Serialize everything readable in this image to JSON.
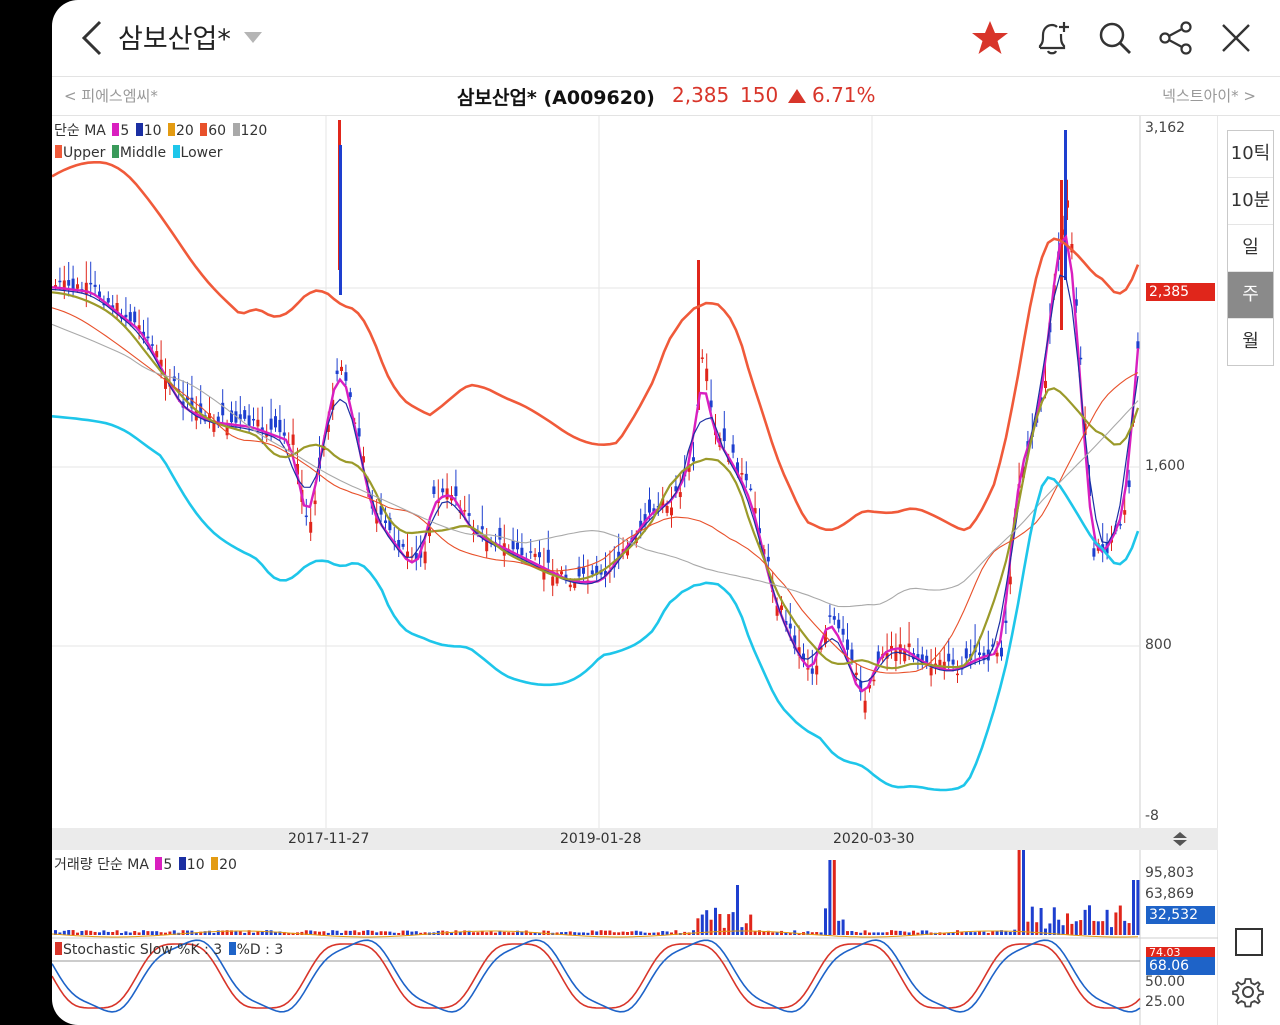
{
  "header": {
    "title": "삼보산업*",
    "icons": [
      "back-icon",
      "star-icon",
      "alarm-add-icon",
      "search-icon",
      "share-icon",
      "close-icon"
    ]
  },
  "stock_bar": {
    "prev_stock": "< 피에스엠씨*",
    "name": "삼보산업* (A009620)",
    "price": "2,385",
    "change": "150",
    "change_rate": "6.71%",
    "next_stock": "넥스트아이* >",
    "up_color": "#d8352a"
  },
  "periods": [
    {
      "label": "10틱",
      "active": false
    },
    {
      "label": "10분",
      "active": false
    },
    {
      "label": "일",
      "active": false
    },
    {
      "label": "주",
      "active": true
    },
    {
      "label": "월",
      "active": false
    }
  ],
  "price_chart": {
    "legend_ma_prefix": "단순 MA",
    "ma_periods": [
      {
        "label": "5",
        "color": "#d91fbf"
      },
      {
        "label": "10",
        "color": "#1b2fa3"
      },
      {
        "label": "20",
        "color": "#e39b12"
      },
      {
        "label": "60",
        "color": "#e8512b"
      },
      {
        "label": "120",
        "color": "#a9a9a9"
      }
    ],
    "bands": [
      {
        "label": "Upper",
        "color": "#f05a3a"
      },
      {
        "label": "Middle",
        "color": "#3a9a5a"
      },
      {
        "label": "Lower",
        "color": "#1ec6ea"
      }
    ],
    "y_labels": [
      "3,162",
      "1,600",
      "800",
      "-8"
    ],
    "current_tag": "2,385",
    "x_labels": [
      "2017-11-27",
      "2019-01-28",
      "2020-03-30"
    ]
  },
  "volume_chart": {
    "legend_prefix": "거래량 단순 MA",
    "ma_periods": [
      {
        "label": "5",
        "color": "#d91fbf"
      },
      {
        "label": "10",
        "color": "#1b2fa3"
      },
      {
        "label": "20",
        "color": "#e39b12"
      }
    ],
    "y_labels": [
      "95,803",
      "63,869"
    ],
    "current_tag": "32,532"
  },
  "stochastic": {
    "legend_k": "Stochastic Slow %K : 3",
    "legend_d": "%D : 3",
    "k_color": "#d8352a",
    "d_color": "#1e63c8",
    "y_labels": [
      "50.00",
      "25.00"
    ],
    "k_tag": "74.03",
    "d_tag": "68.06"
  },
  "chart_data": {
    "type": "candlestick",
    "y_axis_ticks": [
      3162,
      1600,
      800,
      -8
    ],
    "x_axis_ticks": [
      "2017-11-27",
      "2019-01-28",
      "2020-03-30"
    ],
    "last_close": 2385,
    "change": 150,
    "change_rate_pct": 6.71,
    "volume_axis_ticks": [
      95803,
      63869
    ],
    "last_volume": 32532,
    "stochastic_last": {
      "k": 74.03,
      "d": 68.06
    },
    "stochastic_ticks": [
      50.0,
      25.0
    ]
  }
}
